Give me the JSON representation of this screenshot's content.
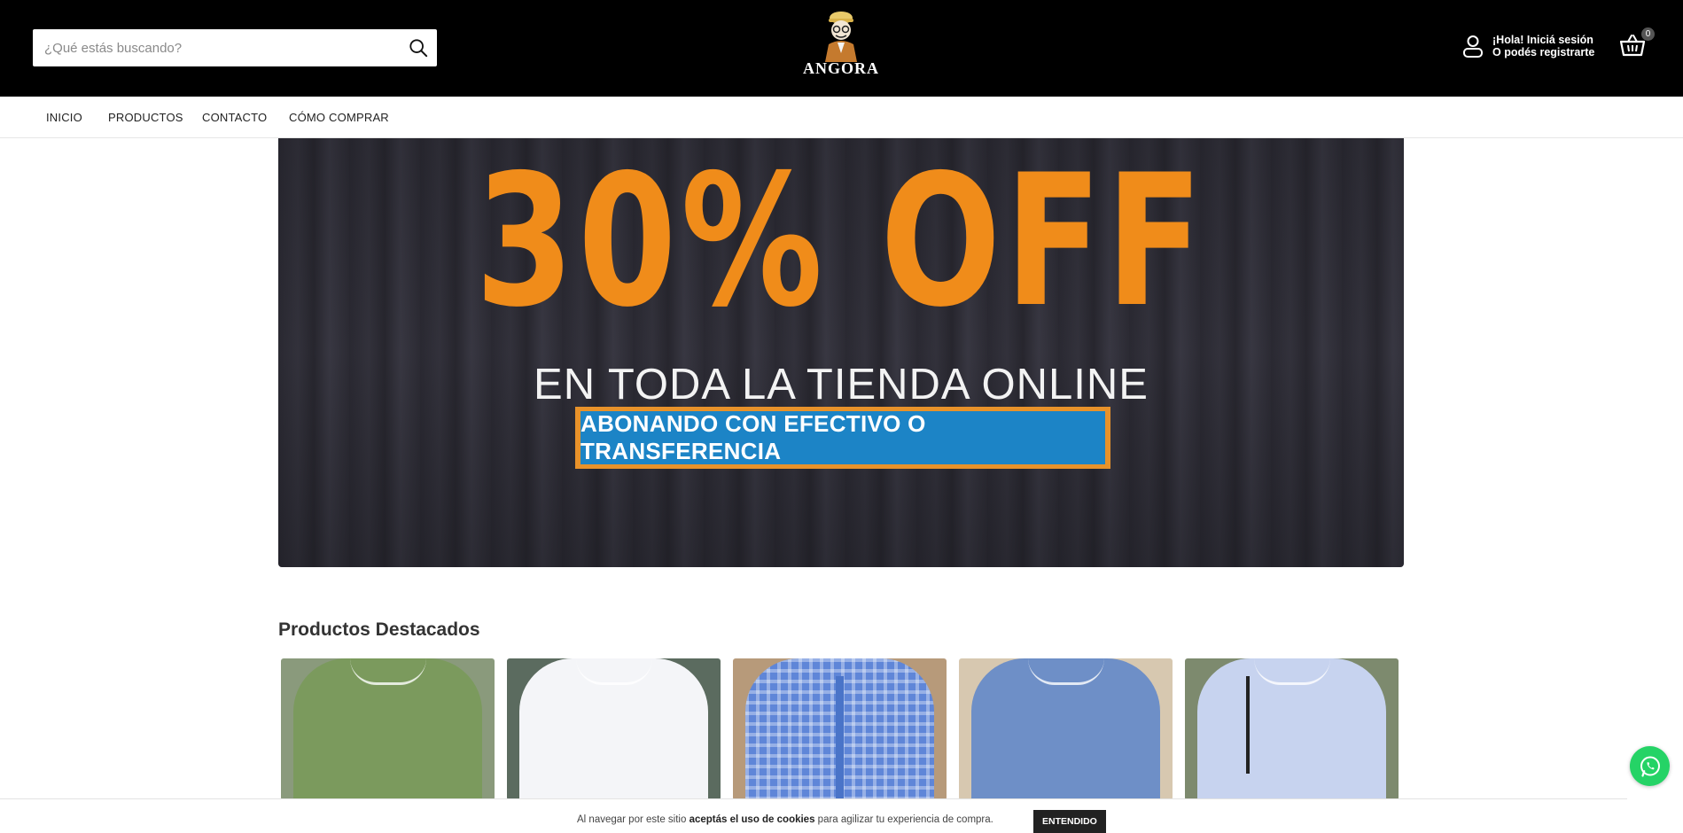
{
  "header": {
    "search": {
      "placeholder": "¿Qué estás buscando?"
    },
    "logo_text": "ANGORA",
    "account": {
      "line1": "¡Hola! Iniciá sesión",
      "line2": "O podés registrarte"
    },
    "cart_count": "0"
  },
  "nav": {
    "items": [
      "INICIO",
      "PRODUCTOS",
      "CONTACTO",
      "CÓMO COMPRAR"
    ]
  },
  "banner": {
    "headline": "30% OFF",
    "subline": "EN TODA LA TIENDA ONLINE",
    "strip": "ABONANDO CON EFECTIVO O TRANSFERENCIA",
    "colors": {
      "headline": "#f08c1a",
      "strip": "#1c84c6",
      "strip_border": "#e8922a"
    }
  },
  "featured": {
    "title": "Productos Destacados",
    "products": [
      {
        "color": "#7b9a5d"
      },
      {
        "color": "#f4f5f8"
      },
      {
        "color": "#5f86d8"
      },
      {
        "color": "#6e8fc7"
      },
      {
        "color": "#c7d3ef"
      }
    ]
  },
  "cookie": {
    "prefix": "Al navegar por este sitio ",
    "bold": "aceptás el uso de cookies",
    "suffix": " para agilizar tu experiencia de compra.",
    "button": "ENTENDIDO"
  }
}
